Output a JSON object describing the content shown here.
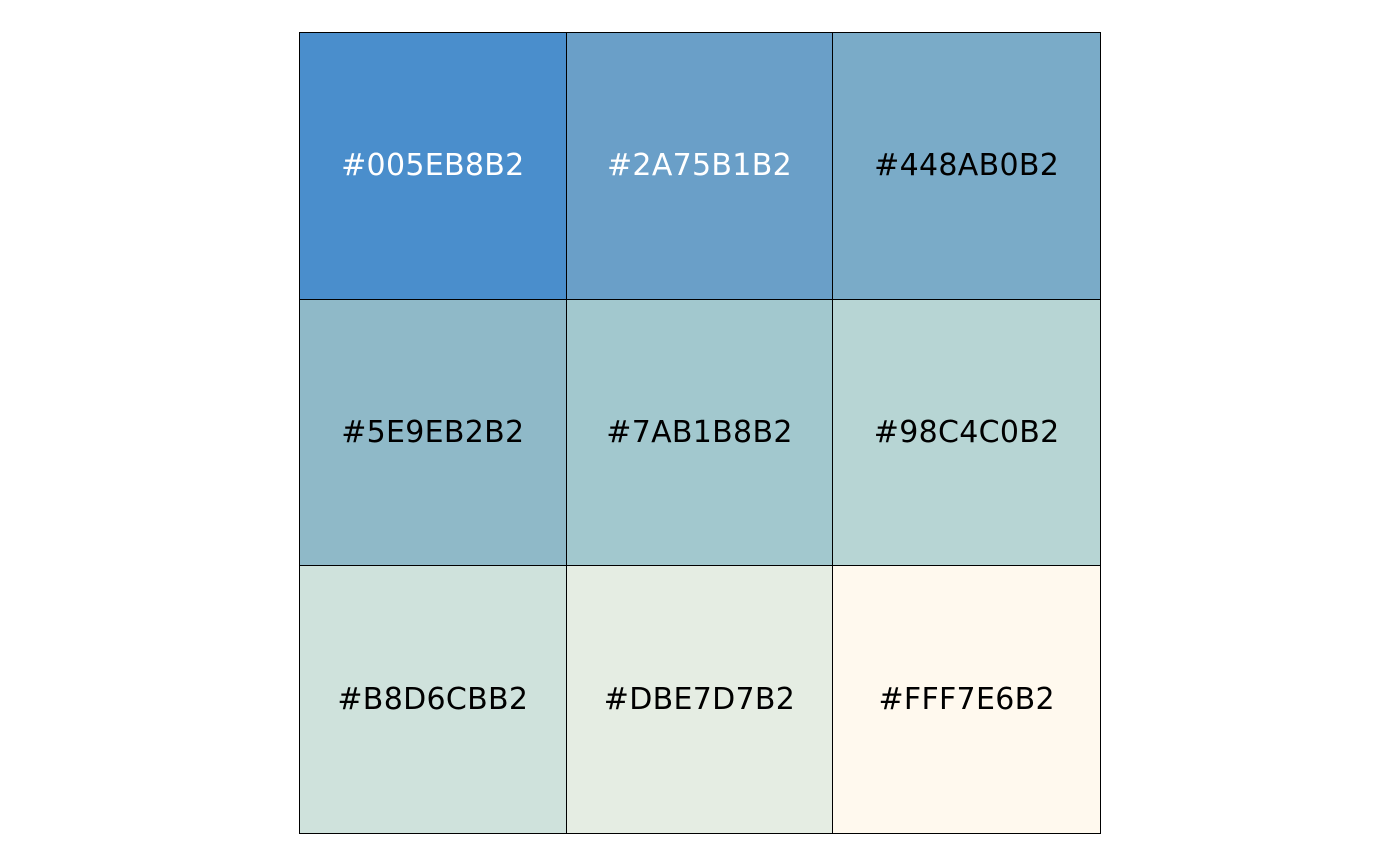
{
  "swatches": [
    {
      "label": "#005EB8B2",
      "color": "#4A8ECC",
      "text_color": "#FFFFFF"
    },
    {
      "label": "#2A75B1B2",
      "color": "#6A9FC8",
      "text_color": "#FFFFFF"
    },
    {
      "label": "#448AB0B2",
      "color": "#7AABC8",
      "text_color": "#000000"
    },
    {
      "label": "#5E9EB2B2",
      "color": "#8FB9C8",
      "text_color": "#000000"
    },
    {
      "label": "#7AB1B8B2",
      "color": "#A2C8CE",
      "text_color": "#000000"
    },
    {
      "label": "#98C4C0B2",
      "color": "#B7D5D4",
      "text_color": "#000000"
    },
    {
      "label": "#B8D6CBB2",
      "color": "#CFE2DC",
      "text_color": "#000000"
    },
    {
      "label": "#DBE7D7B2",
      "color": "#E5EDE3",
      "text_color": "#000000"
    },
    {
      "label": "#FFF7E6B2",
      "color": "#FFF9EE",
      "text_color": "#000000"
    }
  ]
}
